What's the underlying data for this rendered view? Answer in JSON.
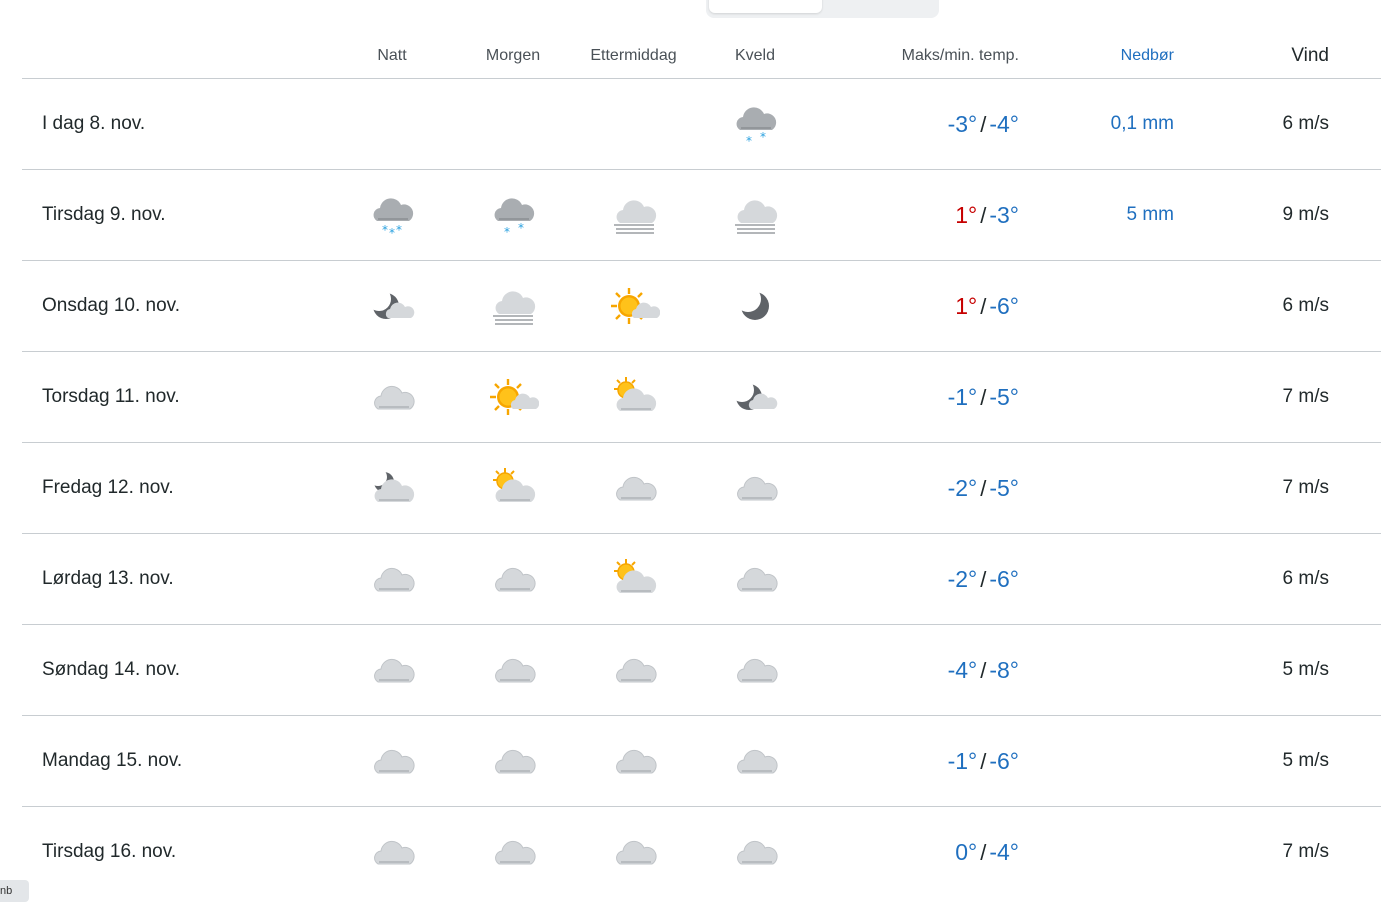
{
  "headers": {
    "day": "",
    "night": "Natt",
    "morning": "Morgen",
    "afternoon": "Ettermiddag",
    "evening": "Kveld",
    "temp": "Maks/min. temp.",
    "precip": "Nedbør",
    "wind": "Vind"
  },
  "colors": {
    "warm": "#c60000",
    "cold": "#1f6fbf",
    "precip": "#1f6fbf"
  },
  "rows": [
    {
      "day": "I dag 8. nov.",
      "night": "",
      "morning": "",
      "afternoon": "",
      "evening": "cloud-snow-icon",
      "max": "-3°",
      "min": "-4°",
      "max_warm": false,
      "precip": "0,1 mm",
      "wind": "6 m/s"
    },
    {
      "day": "Tirsdag 9. nov.",
      "night": "cloud-heavy-snow-icon",
      "morning": "cloud-snow-icon",
      "afternoon": "fog-icon",
      "evening": "fog-icon",
      "max": "1°",
      "min": "-3°",
      "max_warm": true,
      "precip": "5 mm",
      "wind": "9 m/s"
    },
    {
      "day": "Onsdag 10. nov.",
      "night": "moon-cloud-icon",
      "morning": "fog-icon",
      "afternoon": "sun-cloud-icon",
      "evening": "moon-icon",
      "max": "1°",
      "min": "-6°",
      "max_warm": true,
      "precip": "",
      "wind": "6 m/s"
    },
    {
      "day": "Torsdag 11. nov.",
      "night": "cloud-icon",
      "morning": "sun-cloud-icon",
      "afternoon": "sun-behind-cloud-icon",
      "evening": "moon-cloud-icon",
      "max": "-1°",
      "min": "-5°",
      "max_warm": false,
      "precip": "",
      "wind": "7 m/s"
    },
    {
      "day": "Fredag 12. nov.",
      "night": "moon-behind-cloud-icon",
      "morning": "sun-behind-cloud-icon",
      "afternoon": "cloud-icon",
      "evening": "cloud-icon",
      "max": "-2°",
      "min": "-5°",
      "max_warm": false,
      "precip": "",
      "wind": "7 m/s"
    },
    {
      "day": "Lørdag 13. nov.",
      "night": "cloud-icon",
      "morning": "cloud-icon",
      "afternoon": "sun-behind-cloud-icon",
      "evening": "cloud-icon",
      "max": "-2°",
      "min": "-6°",
      "max_warm": false,
      "precip": "",
      "wind": "6 m/s"
    },
    {
      "day": "Søndag 14. nov.",
      "night": "cloud-icon",
      "morning": "cloud-icon",
      "afternoon": "cloud-icon",
      "evening": "cloud-icon",
      "max": "-4°",
      "min": "-8°",
      "max_warm": false,
      "precip": "",
      "wind": "5 m/s"
    },
    {
      "day": "Mandag 15. nov.",
      "night": "cloud-icon",
      "morning": "cloud-icon",
      "afternoon": "cloud-icon",
      "evening": "cloud-icon",
      "max": "-1°",
      "min": "-6°",
      "max_warm": false,
      "precip": "",
      "wind": "5 m/s"
    },
    {
      "day": "Tirsdag 16. nov.",
      "night": "cloud-icon",
      "morning": "cloud-icon",
      "afternoon": "cloud-icon",
      "evening": "cloud-icon",
      "max": "0°",
      "min": "-4°",
      "max_warm": false,
      "precip": "",
      "wind": "7 m/s"
    }
  ]
}
